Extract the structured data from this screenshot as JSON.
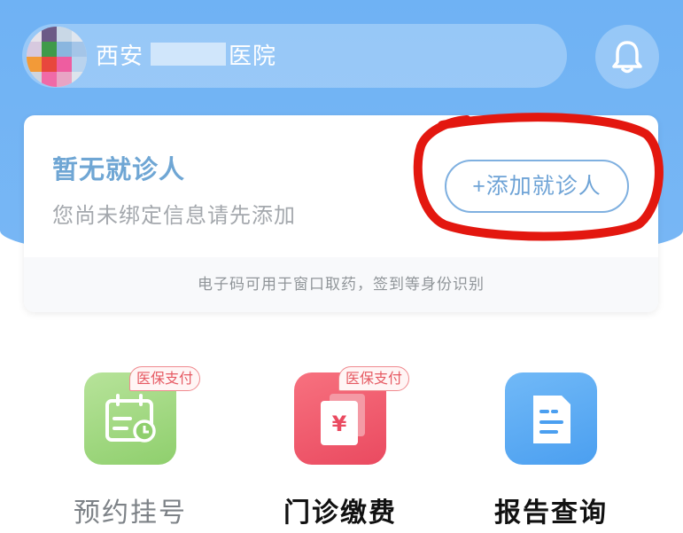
{
  "header": {
    "hospital_name": "西安市某某医院",
    "hospital_name_prefix": "西安",
    "hospital_name_suffix": "医院",
    "notification_icon": "bell-icon"
  },
  "patient_card": {
    "title": "暂无就诊人",
    "subtitle": "您尚未绑定信息请先添加",
    "add_button": "+添加就诊人",
    "footer_note": "电子码可用于窗口取药，签到等身份识别"
  },
  "services": [
    {
      "label": "预约挂号",
      "badge": "医保支付",
      "icon": "calendar-icon",
      "color": "#9ed67b"
    },
    {
      "label": "门诊缴费",
      "badge": "医保支付",
      "icon": "yuan-bill-icon",
      "color": "#f0566a"
    },
    {
      "label": "报告查询",
      "badge": "",
      "icon": "report-document-icon",
      "color": "#56a9f2"
    }
  ],
  "colors": {
    "header_bg": "#74b4f4",
    "accent_blue": "#6fa6d4",
    "annotation_red": "#e3170f"
  }
}
